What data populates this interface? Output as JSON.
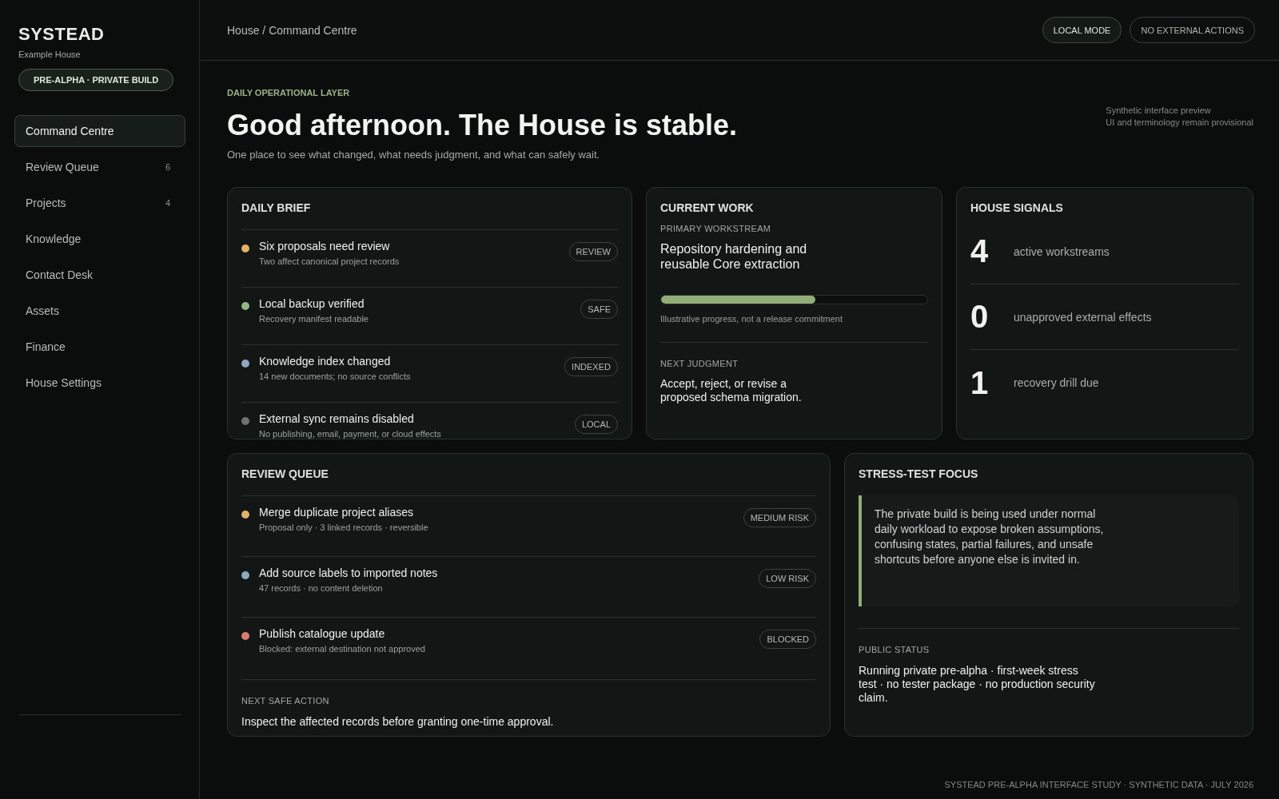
{
  "sidebar": {
    "brand": "SYSTEAD",
    "subtitle": "Example House",
    "build_badge": "PRE-ALPHA · PRIVATE BUILD",
    "items": [
      {
        "label": "Command Centre",
        "selected": true
      },
      {
        "label": "Review Queue",
        "count": "6",
        "selected": false
      },
      {
        "label": "Projects",
        "count": "4",
        "selected": false
      },
      {
        "label": "Knowledge",
        "selected": false
      },
      {
        "label": "Contact Desk",
        "selected": false
      },
      {
        "label": "Assets",
        "selected": false
      },
      {
        "label": "Finance",
        "selected": false
      },
      {
        "label": "House Settings",
        "selected": false
      }
    ]
  },
  "header": {
    "breadcrumb": "House / Command Centre",
    "pills": [
      {
        "label": "LOCAL MODE",
        "selected": true
      },
      {
        "label": "NO EXTERNAL ACTIONS",
        "selected": false
      }
    ]
  },
  "hero": {
    "eyebrow": "DAILY OPERATIONAL LAYER",
    "title": "Good afternoon. The House is stable.",
    "subtitle": "One place to see what changed, what needs judgment, and what can safely wait.",
    "note": [
      "Synthetic interface preview",
      "UI and terminology remain provisional"
    ]
  },
  "daily_brief": {
    "title": "DAILY BRIEF",
    "items": [
      {
        "title": "Six proposals need review",
        "detail": "Two affect canonical project records",
        "tag": "REVIEW",
        "color": "#e3b266"
      },
      {
        "title": "Local backup verified",
        "detail": "Recovery manifest readable",
        "tag": "SAFE",
        "color": "#93b685"
      },
      {
        "title": "Knowledge index changed",
        "detail": "14 new documents; no source conflicts",
        "tag": "INDEXED",
        "color": "#8fa9bf"
      },
      {
        "title": "External sync remains disabled",
        "detail": "No publishing, email, payment, or cloud effects",
        "tag": "LOCAL",
        "color": "#6c726e"
      }
    ]
  },
  "current_work": {
    "title": "CURRENT WORK",
    "workstream_label": "PRIMARY WORKSTREAM",
    "workstream": "Repository hardening and reusable Core extraction",
    "level": 0.58,
    "progress_note": "Illustrative progress, not a release commitment",
    "judgment_label": "NEXT JUDGMENT",
    "judgment": "Accept, reject, or revise a proposed schema migration."
  },
  "house_signals": {
    "title": "HOUSE SIGNALS",
    "items": [
      {
        "value": "4",
        "label": "active workstreams"
      },
      {
        "value": "0",
        "label": "unapproved external effects"
      },
      {
        "value": "1",
        "label": "recovery drill due"
      }
    ]
  },
  "review_queue": {
    "title": "REVIEW QUEUE",
    "items": [
      {
        "title": "Merge duplicate project aliases",
        "detail": "Proposal only · 3 linked records · reversible",
        "tag": "MEDIUM RISK",
        "color": "#e3b266"
      },
      {
        "title": "Add source labels to imported notes",
        "detail": "47 records · no content deletion",
        "tag": "LOW RISK",
        "color": "#8fa9bf"
      },
      {
        "title": "Publish catalogue update",
        "detail": "Blocked: external destination not approved",
        "tag": "BLOCKED",
        "color": "#dc7b6e"
      }
    ],
    "next_label": "NEXT SAFE ACTION",
    "next": "Inspect the affected records before granting one-time approval."
  },
  "stress_test": {
    "title": "STRESS-TEST FOCUS",
    "quote": "The private build is being used under normal daily workload to expose broken assumptions, confusing states, partial failures, and unsafe shortcuts before anyone else is invited in.",
    "status_label": "PUBLIC STATUS",
    "status": "Running private pre-alpha · first-week stress test · no tester package · no production security claim."
  },
  "footer": "SYSTEAD PRE-ALPHA INTERFACE STUDY · SYNTHETIC DATA · JULY 2026"
}
